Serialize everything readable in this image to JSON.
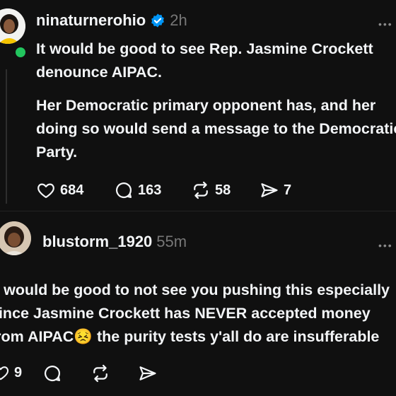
{
  "post1": {
    "username": "ninaturnerohio",
    "time": "2h",
    "lines_p1": [
      "It would be good to see Rep. Jasmine Crockett",
      "denounce AIPAC."
    ],
    "lines_p2": [
      "Her Democratic primary opponent has, and her",
      "doing so would send a message to the Democratic",
      "Party."
    ],
    "likes": "684",
    "replies": "163",
    "reposts": "58",
    "shares": "7"
  },
  "post2": {
    "username": "blustorm_1920",
    "time": "55m",
    "lines": [
      "It would be good to not see you pushing this especially",
      "since Jasmine Crockett has NEVER accepted money",
      "from AIPAC😣 the purity tests y'all do are insufferable"
    ],
    "likes": "9"
  },
  "colors": {
    "background": "#101010",
    "text": "#f3f5f7",
    "muted": "#777777",
    "verified": "#0095f6",
    "online": "#22c55e"
  },
  "icons": [
    "verified-badge-icon",
    "heart-icon",
    "comment-icon",
    "repost-icon",
    "share-icon",
    "more-icon"
  ]
}
